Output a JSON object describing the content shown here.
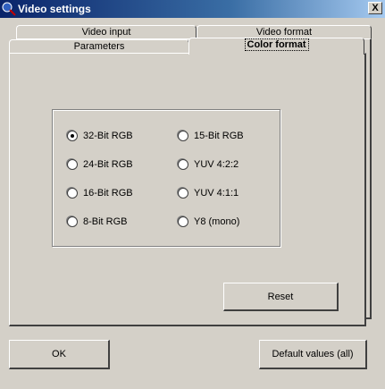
{
  "window": {
    "title": "Video settings",
    "close_glyph": "X"
  },
  "tabs": {
    "video_input": "Video input",
    "video_format": "Video format",
    "parameters": "Parameters",
    "color_format": "Color format"
  },
  "color_format": {
    "options": [
      {
        "label": "32-Bit RGB",
        "selected": true
      },
      {
        "label": "24-Bit RGB",
        "selected": false
      },
      {
        "label": "16-Bit RGB",
        "selected": false
      },
      {
        "label": "8-Bit RGB",
        "selected": false
      },
      {
        "label": "15-Bit RGB",
        "selected": false
      },
      {
        "label": "YUV 4:2:2",
        "selected": false
      },
      {
        "label": "YUV 4:1:1",
        "selected": false
      },
      {
        "label": "Y8 (mono)",
        "selected": false
      }
    ],
    "reset_label": "Reset"
  },
  "footer": {
    "ok_label": "OK",
    "defaults_label": "Default values (all)"
  }
}
